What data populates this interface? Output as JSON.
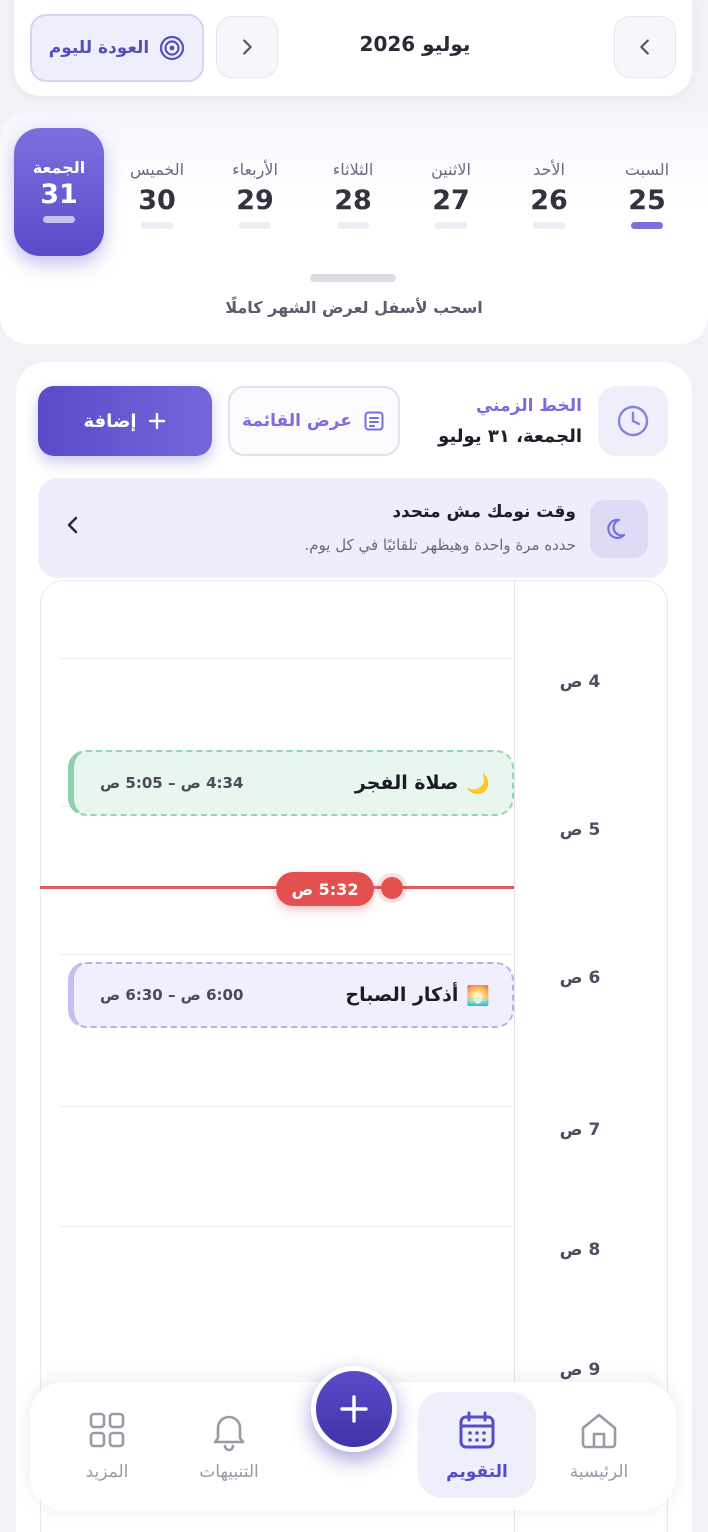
{
  "header": {
    "month_title": "يوليو 2026",
    "today_button": "العودة لليوم",
    "prev_icon": "chevron-left-icon",
    "next_icon": "chevron-right-icon"
  },
  "week": {
    "days": [
      {
        "name": "السبت",
        "num": "25"
      },
      {
        "name": "الأحد",
        "num": "26"
      },
      {
        "name": "الاثنين",
        "num": "27"
      },
      {
        "name": "الثلاثاء",
        "num": "28"
      },
      {
        "name": "الأربعاء",
        "num": "29"
      },
      {
        "name": "الخميس",
        "num": "30"
      },
      {
        "name": "الجمعة",
        "num": "31"
      }
    ],
    "hint": "اسحب لأسفل لعرض الشهر كاملًا"
  },
  "timeline": {
    "title": "الخط الزمني",
    "date": "الجمعة، ٣١ يوليو",
    "list_button": "عرض القائمة",
    "add_button": "إضافة"
  },
  "sleep": {
    "title": "وقت نومك مش متحدد",
    "subtitle": "حدده مرة واحدة وهيظهر تلقائيًا في كل يوم."
  },
  "hours": [
    "4 ص",
    "5 ص",
    "6 ص",
    "7 ص",
    "8 ص",
    "9 ص"
  ],
  "events": [
    {
      "emoji": "🌙",
      "title": "صلاة الفجر",
      "time": "4:34 ص – 5:05 ص"
    },
    {
      "emoji": "🌅",
      "title": "أذكار الصباح",
      "time": "6:00 ص – 6:30 ص"
    }
  ],
  "now": {
    "label": "5:32 ص"
  },
  "nav": {
    "home": "الرئيسية",
    "calendar": "التقويم",
    "alerts": "التنبيهات",
    "more": "المزيد"
  },
  "colors": {
    "accent": "#5a4cc9",
    "now": "#e2504f",
    "fajr_bg": "#e9f6ef",
    "adhkar_bg": "#f1effb"
  }
}
